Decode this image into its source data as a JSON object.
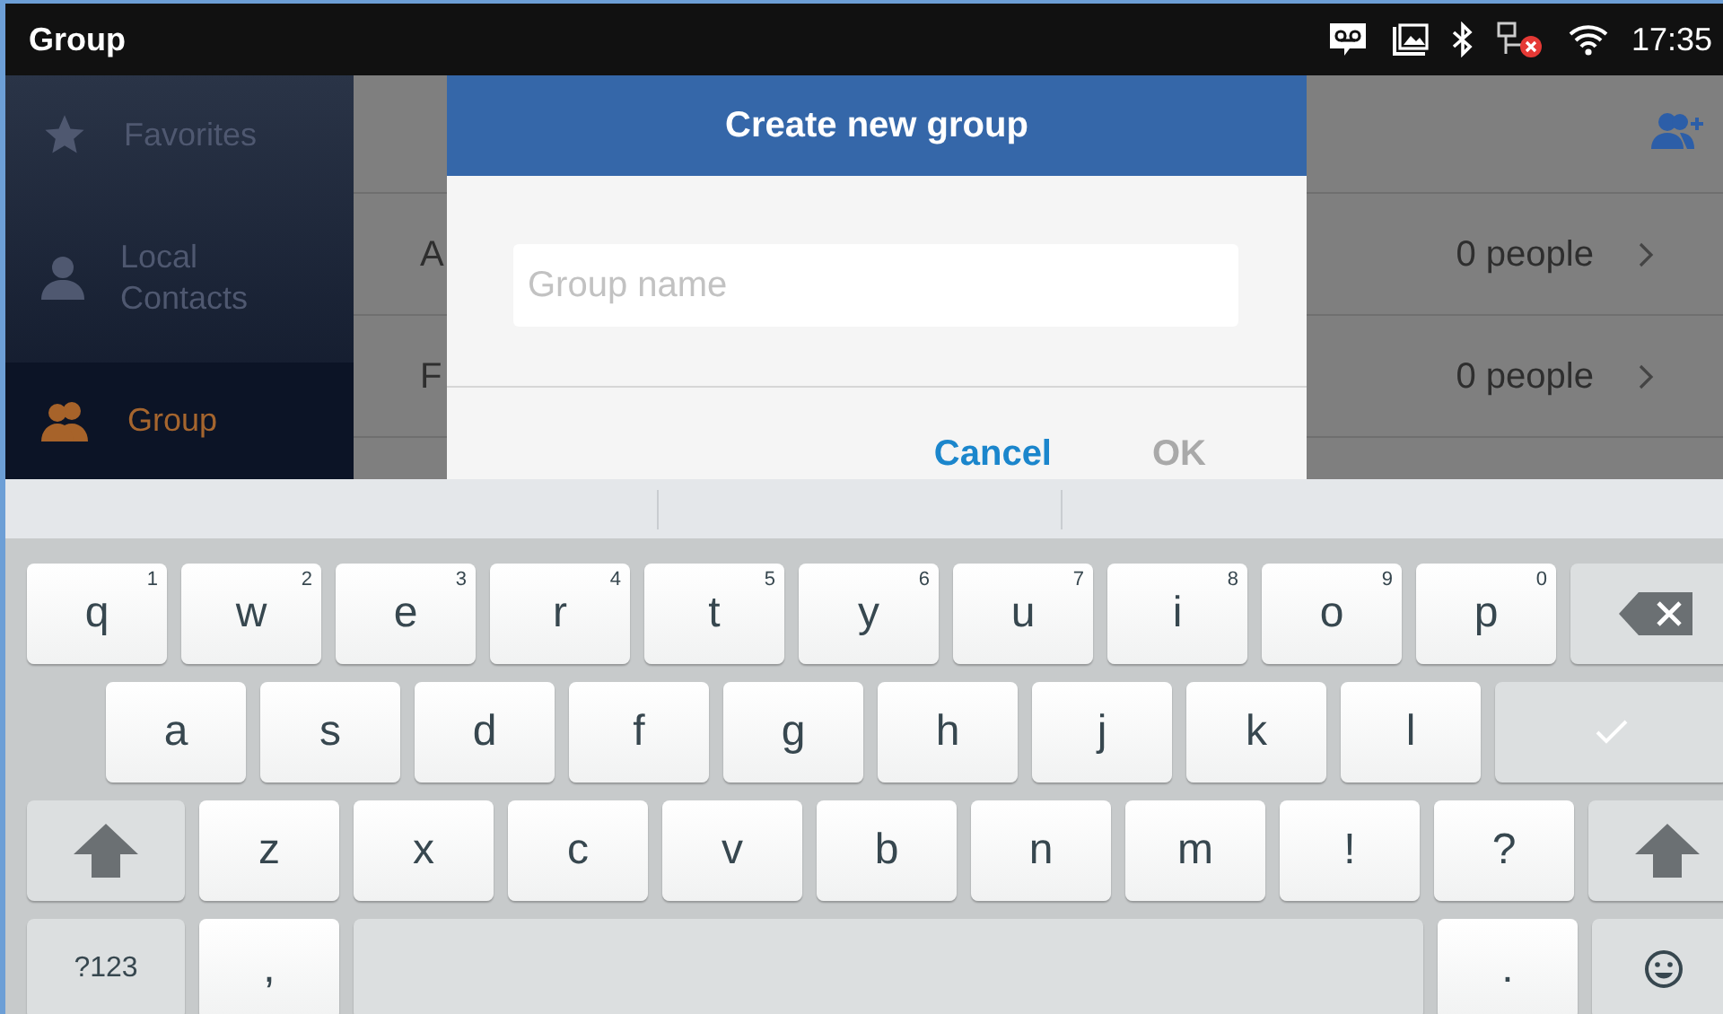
{
  "status_bar": {
    "title": "Group",
    "time": "17:35"
  },
  "sidebar": {
    "items": [
      {
        "label": "Favorites",
        "kind": "favorites",
        "selected": false
      },
      {
        "label": "Local Contacts",
        "kind": "contacts",
        "selected": false
      },
      {
        "label": "Group",
        "kind": "groups",
        "selected": true
      }
    ]
  },
  "groups": [
    {
      "name": "A",
      "count": "0 people"
    },
    {
      "name": "F",
      "count": "0 people"
    }
  ],
  "dialog": {
    "title": "Create new group",
    "field": {
      "placeholder": "Group name"
    },
    "buttons": [
      {
        "label": "Cancel",
        "disabled": false
      },
      {
        "label": "OK",
        "disabled": true
      }
    ]
  },
  "keyboard": {
    "rows": [
      {
        "keys": [
          {
            "kind": "letter",
            "label": "q",
            "hint": "1"
          },
          {
            "kind": "letter",
            "label": "w",
            "hint": "2"
          },
          {
            "kind": "letter",
            "label": "e",
            "hint": "3"
          },
          {
            "kind": "letter",
            "label": "r",
            "hint": "4"
          },
          {
            "kind": "letter",
            "label": "t",
            "hint": "5"
          },
          {
            "kind": "letter",
            "label": "y",
            "hint": "6"
          },
          {
            "kind": "letter",
            "label": "u",
            "hint": "7"
          },
          {
            "kind": "letter",
            "label": "i",
            "hint": "8"
          },
          {
            "kind": "letter",
            "label": "o",
            "hint": "9"
          },
          {
            "kind": "letter",
            "label": "p",
            "hint": "0"
          },
          {
            "kind": "backspace"
          }
        ]
      },
      {
        "keys": [
          {
            "kind": "letter",
            "label": "a"
          },
          {
            "kind": "letter",
            "label": "s"
          },
          {
            "kind": "letter",
            "label": "d"
          },
          {
            "kind": "letter",
            "label": "f"
          },
          {
            "kind": "letter",
            "label": "g"
          },
          {
            "kind": "letter",
            "label": "h"
          },
          {
            "kind": "letter",
            "label": "j"
          },
          {
            "kind": "letter",
            "label": "k"
          },
          {
            "kind": "letter",
            "label": "l"
          },
          {
            "kind": "enter"
          }
        ]
      },
      {
        "keys": [
          {
            "kind": "shift"
          },
          {
            "kind": "letter",
            "label": "z"
          },
          {
            "kind": "letter",
            "label": "x"
          },
          {
            "kind": "letter",
            "label": "c"
          },
          {
            "kind": "letter",
            "label": "v"
          },
          {
            "kind": "letter",
            "label": "b"
          },
          {
            "kind": "letter",
            "label": "n"
          },
          {
            "kind": "letter",
            "label": "m"
          },
          {
            "kind": "letter",
            "label": "!"
          },
          {
            "kind": "letter",
            "label": "?"
          },
          {
            "kind": "shift"
          }
        ]
      },
      {
        "keys": [
          {
            "kind": "symbols",
            "label": "?123"
          },
          {
            "kind": "letter",
            "label": ","
          },
          {
            "kind": "space"
          },
          {
            "kind": "letter",
            "label": "."
          },
          {
            "kind": "emoji"
          }
        ]
      }
    ]
  }
}
